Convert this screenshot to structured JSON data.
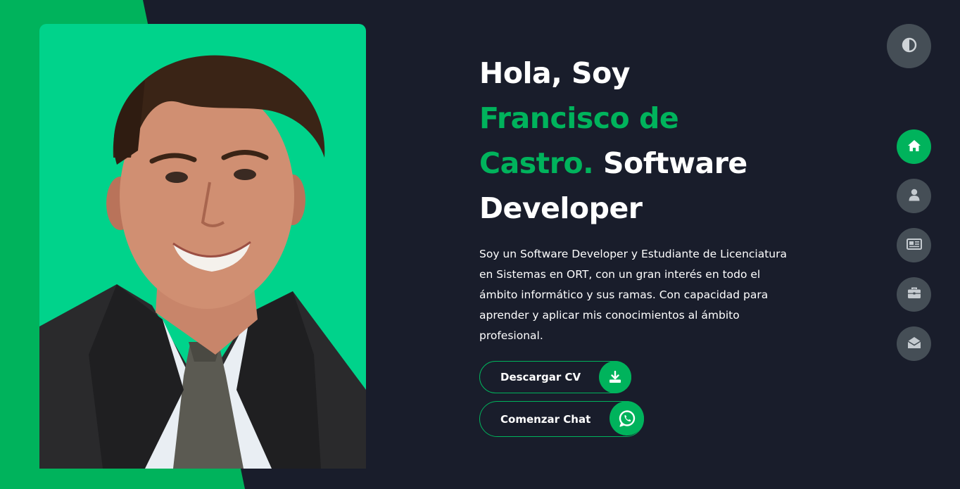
{
  "hero": {
    "title_prefix": "Hola, Soy",
    "name": "Francisco de Castro.",
    "title_suffix": "Software Developer",
    "description": "Soy un Software Developer y Estudiante de Licenciatura en Sistemas en ORT, con un gran interés en todo el ámbito informático y sus ramas. Con capacidad para aprender y aplicar mis conocimientos al ámbito profesional."
  },
  "buttons": {
    "download_cv": {
      "label": "Descargar CV",
      "icon": "download-icon"
    },
    "start_chat": {
      "label": "Comenzar Chat",
      "icon": "whatsapp-icon"
    }
  },
  "theme_toggle": {
    "icon": "contrast-icon"
  },
  "nav": {
    "items": [
      {
        "id": "home",
        "icon": "home-icon",
        "active": true
      },
      {
        "id": "about",
        "icon": "user-icon",
        "active": false
      },
      {
        "id": "portfolio",
        "icon": "newspaper-icon",
        "active": false
      },
      {
        "id": "experience",
        "icon": "briefcase-icon",
        "active": false
      },
      {
        "id": "contact",
        "icon": "envelope-open-icon",
        "active": false
      }
    ]
  },
  "colors": {
    "accent": "#00b35c",
    "photo_background": "#00d38b",
    "page_background": "#191d2b",
    "icon_circle": "#454e56"
  }
}
